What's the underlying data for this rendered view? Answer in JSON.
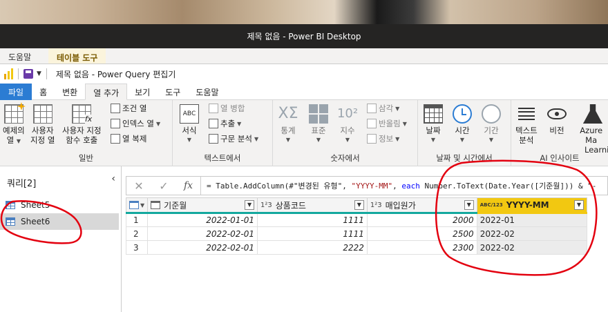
{
  "window": {
    "pbi_title": "제목 없음 - Power BI Desktop",
    "pbi_tabs": [
      "도움말",
      "테이블 도구"
    ],
    "pq_title": "제목 없음 - Power Query 편집기"
  },
  "ribbon_tabs": [
    "파일",
    "홈",
    "변환",
    "열 추가",
    "보기",
    "도구",
    "도움말"
  ],
  "ribbon": {
    "general": {
      "label": "일반",
      "example_col": [
        "예제의",
        "열"
      ],
      "custom_col": [
        "사용자",
        "지정 열"
      ],
      "invoke_fn": [
        "사용자 지정",
        "함수 호출"
      ],
      "conditional": "조건 열",
      "index": "인덱스 열",
      "duplicate": "열 복제"
    },
    "text": {
      "label": "텍스트에서",
      "format": "서식",
      "merge": "열 병합",
      "extract": "추출",
      "parse": "구문 분석"
    },
    "number": {
      "label": "숫자에서",
      "stats": "통계",
      "standard": "표준",
      "scientific": "지수",
      "trig": "삼각",
      "round": "반올림",
      "info": "정보"
    },
    "datetime": {
      "label": "날짜 및 시간에서",
      "date": "날짜",
      "time": "시간",
      "duration": "기간"
    },
    "ai": {
      "label": "AI 인사이트",
      "text_analytics": [
        "텍스트",
        "분석"
      ],
      "vision": "비전",
      "azure_ml": [
        "Azure Ma",
        "Learni"
      ]
    }
  },
  "queries": {
    "header": "쿼리[2]",
    "items": [
      "Sheet5",
      "Sheet6"
    ]
  },
  "formula_bar": {
    "part1": "= Table.AddColumn(#\"변경된 유형\", ",
    "str1": "\"YYYY-MM\"",
    "part2": ", ",
    "kw": "each",
    "part3": " Number.ToText(Date.Year([기준월])) & \"-"
  },
  "table": {
    "columns": [
      {
        "name": "기준월",
        "type": "date"
      },
      {
        "name": "상품코드",
        "type": "1²3"
      },
      {
        "name": "매입원가",
        "type": "1²3"
      },
      {
        "name": "YYYY-MM",
        "type": "ABC/123"
      }
    ],
    "rows": [
      {
        "no": "1",
        "month": "2022-01-01",
        "code": "1111",
        "cost": "2000",
        "ym": "2022-01"
      },
      {
        "no": "2",
        "month": "2022-02-01",
        "code": "1111",
        "cost": "2500",
        "ym": "2022-02"
      },
      {
        "no": "3",
        "month": "2022-02-01",
        "code": "2222",
        "cost": "2300",
        "ym": "2022-02"
      }
    ]
  },
  "colors": {
    "accent_blue": "#2b7cd3",
    "highlight_yellow": "#f2c811",
    "annotation_red": "#e3000f",
    "teal_quality": "#13a89e"
  }
}
